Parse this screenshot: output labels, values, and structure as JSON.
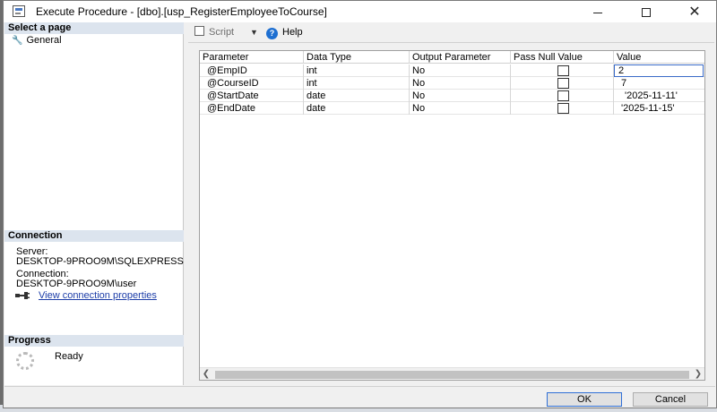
{
  "window": {
    "title": "Execute Procedure - [dbo].[usp_RegisterEmployeeToCourse]",
    "minimize_label": "",
    "maximize_label": "",
    "close_label": "✕"
  },
  "left_panel": {
    "select_page_header": "Select a page",
    "pages": [
      {
        "label": "General",
        "icon": "wrench-icon"
      }
    ],
    "connection_header": "Connection",
    "server_label": "Server:",
    "server_value": "DESKTOP-9PROO9M\\SQLEXPRESS",
    "connection_label": "Connection:",
    "connection_value": "DESKTOP-9PROO9M\\user",
    "view_connection_link": "View connection properties",
    "progress_header": "Progress",
    "progress_status": "Ready"
  },
  "toolbar": {
    "script_label": "Script",
    "help_label": "Help"
  },
  "grid": {
    "columns": [
      "Parameter",
      "Data Type",
      "Output Parameter",
      "Pass Null Value",
      "Value"
    ],
    "rows": [
      {
        "parameter": "@EmpID",
        "data_type": "int",
        "output": "No",
        "pass_null": false,
        "value": "2"
      },
      {
        "parameter": "@CourseID",
        "data_type": "int",
        "output": "No",
        "pass_null": false,
        "value": "7"
      },
      {
        "parameter": "@StartDate",
        "data_type": "date",
        "output": "No",
        "pass_null": false,
        "value": "'2025-11-11'"
      },
      {
        "parameter": "@EndDate",
        "data_type": "date",
        "output": "No",
        "pass_null": false,
        "value": "'2025-11-15'"
      }
    ]
  },
  "buttons": {
    "ok_label": "OK",
    "cancel_label": "Cancel"
  },
  "colors": {
    "section_header_bg": "#dce4ee",
    "link": "#1c3da8",
    "help_icon": "#1e6fd1",
    "focus_border": "#3a6bc8"
  }
}
